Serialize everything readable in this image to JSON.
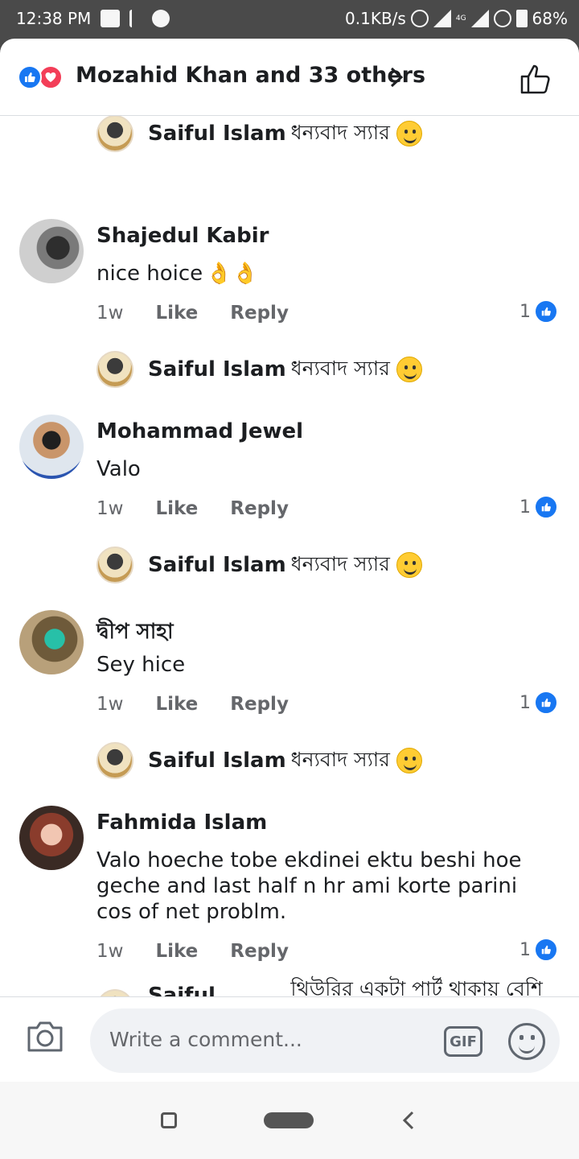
{
  "status_bar": {
    "time": "12:38 PM",
    "net_speed": "0.1KB/s",
    "battery": "68%",
    "net_label": "4G"
  },
  "header": {
    "title": "Mozahid Khan and 33 others"
  },
  "replies_text": {
    "author": "Saiful Islam",
    "thanks": "ধন্যবাদ স্যার",
    "last": "থিউরির একটা পার্ট থাকায় বেশি ম..."
  },
  "comments": [
    {
      "name": "Shajedul Kabir",
      "text": "nice hoice",
      "time": "1w",
      "likes": "1"
    },
    {
      "name": "Mohammad Jewel",
      "text": "Valo",
      "time": "1w",
      "likes": "1"
    },
    {
      "name": "দ্বীপ সাহা",
      "text": "Sey hice",
      "time": "1w",
      "likes": "1"
    },
    {
      "name": "Fahmida Islam",
      "text": "Valo hoeche tobe ekdinei ektu beshi hoe geche and last half n hr ami korte parini cos of net problm.",
      "time": "1w",
      "likes": "1"
    }
  ],
  "actions": {
    "like": "Like",
    "reply": "Reply"
  },
  "composer": {
    "placeholder": "Write a comment...",
    "gif": "GIF"
  },
  "colors": {
    "accent": "#1877f2",
    "love": "#f33e58"
  }
}
